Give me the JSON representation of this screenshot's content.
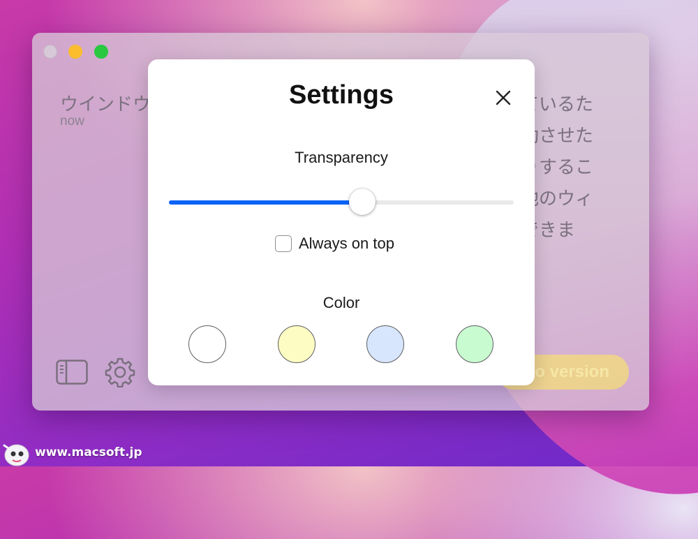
{
  "window": {
    "note_text": "ウインドウ",
    "note_time": "now",
    "jp_lines": [
      "ているた",
      "動させた",
      "りするこ",
      "他のウィ",
      "できま"
    ],
    "pro_button_label": "o version"
  },
  "settings": {
    "title": "Settings",
    "transparency_label": "Transparency",
    "transparency_value": 0.56,
    "always_on_top_label": "Always on top",
    "always_on_top_checked": false,
    "color_label": "Color",
    "swatches": [
      "#ffffff",
      "#fdfcc2",
      "#d7e6fd",
      "#c9fbd1"
    ],
    "accent": "#0b63f6"
  },
  "icons": {
    "close": "close-icon",
    "sidebar": "sidebar-icon",
    "gear": "gear-icon",
    "mascot": "mascot-logo-icon"
  },
  "watermark": {
    "text": "www.macsoft.jp"
  }
}
